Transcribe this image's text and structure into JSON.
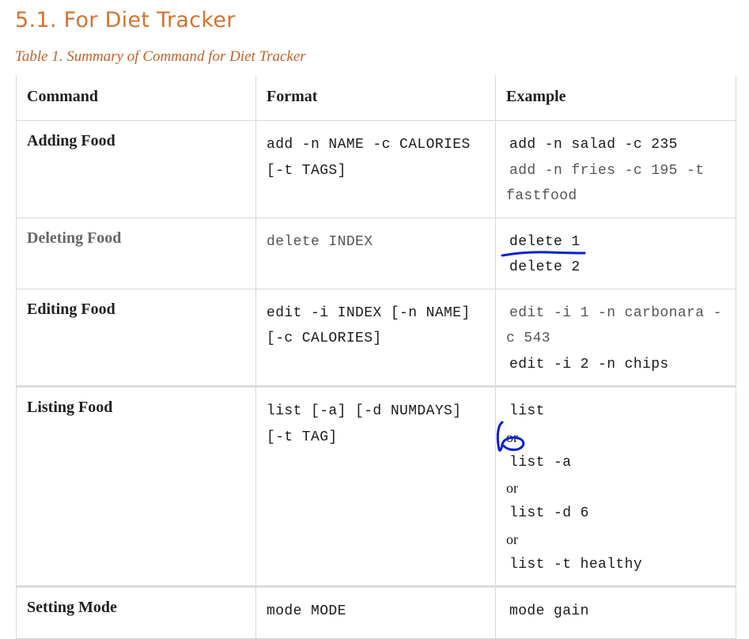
{
  "section": {
    "title": "5.1. For Diet Tracker"
  },
  "caption": "Table 1. Summary of Command for Diet Tracker",
  "table": {
    "headers": {
      "command": "Command",
      "format": "Format",
      "example": "Example"
    },
    "rows": [
      {
        "command": "Adding Food",
        "format": "add -n NAME -c CALORIES [-t TAGS]",
        "examples": [
          "add -n salad -c 235",
          "add -n fries -c 195 -t fastfood"
        ]
      },
      {
        "command": "Deleting Food",
        "format": "delete INDEX",
        "examples": [
          "delete 1",
          "delete 2"
        ]
      },
      {
        "command": "Editing Food",
        "format": "edit -i INDEX [-n NAME] [-c CALORIES]",
        "examples": [
          "edit -i 1 -n carbonara -c 543",
          "edit -i 2 -n chips"
        ]
      },
      {
        "command": "Listing Food",
        "format": "list [-a] [-d NUMDAYS] [-t TAG]",
        "examples": [
          "list",
          "list -a",
          "list -d 6",
          "list -t healthy"
        ],
        "separator": "or"
      },
      {
        "command": "Setting Mode",
        "format": "mode MODE",
        "examples": [
          "mode gain"
        ]
      }
    ]
  },
  "annotation_color": "#0a1fd6"
}
